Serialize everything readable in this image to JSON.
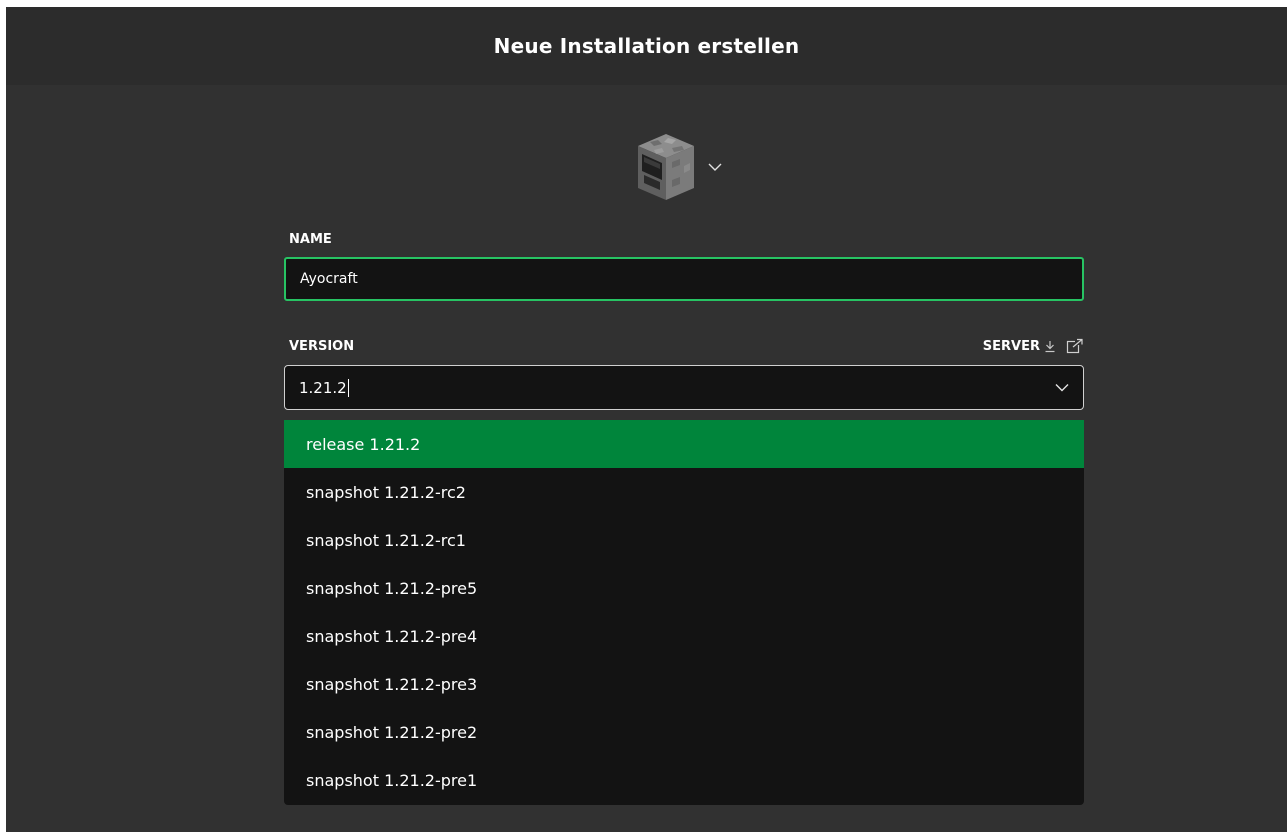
{
  "dialog": {
    "title": "Neue Installation erstellen"
  },
  "icon_picker": {
    "icon": "furnace-icon",
    "toggle_icon": "chevron-down-icon"
  },
  "name_field": {
    "label": "NAME",
    "value": "Ayocraft"
  },
  "version_field": {
    "label": "VERSION",
    "value": "1.21.2",
    "server_link": {
      "label": "SERVER",
      "icons": [
        "download-icon",
        "external-link-icon"
      ]
    }
  },
  "version_options": [
    {
      "label": "release 1.21.2",
      "selected": true
    },
    {
      "label": "snapshot 1.21.2-rc2",
      "selected": false
    },
    {
      "label": "snapshot 1.21.2-rc1",
      "selected": false
    },
    {
      "label": "snapshot 1.21.2-pre5",
      "selected": false
    },
    {
      "label": "snapshot 1.21.2-pre4",
      "selected": false
    },
    {
      "label": "snapshot 1.21.2-pre3",
      "selected": false
    },
    {
      "label": "snapshot 1.21.2-pre2",
      "selected": false
    },
    {
      "label": "snapshot 1.21.2-pre1",
      "selected": false
    }
  ],
  "colors": {
    "background": "#313131",
    "header": "#2c2c2c",
    "input_background": "#131313",
    "focus_border": "#27c363",
    "selected_option": "#00853b"
  }
}
